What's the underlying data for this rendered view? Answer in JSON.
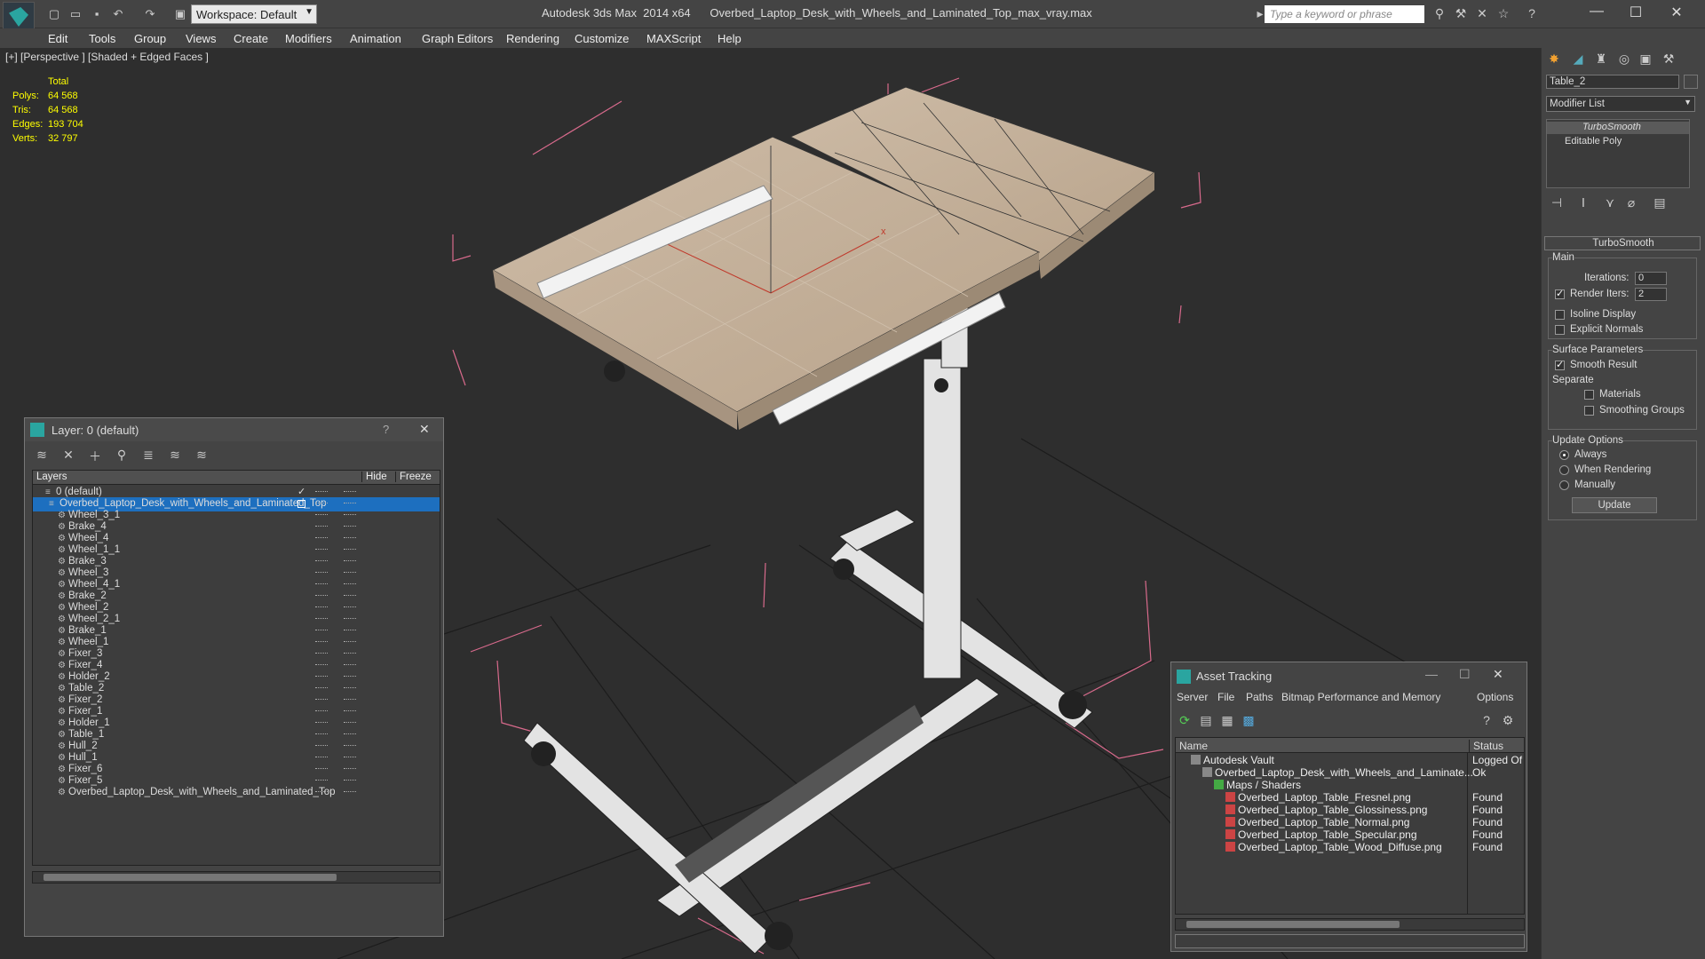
{
  "app": {
    "title": "Autodesk 3ds Max  2014 x64      Overbed_Laptop_Desk_with_Wheels_and_Laminated_Top_max_vray.max",
    "workspace": "Workspace: Default",
    "search_placeholder": "Type a keyword or phrase"
  },
  "menu": [
    "Edit",
    "Tools",
    "Group",
    "Views",
    "Create",
    "Modifiers",
    "Animation",
    "Graph Editors",
    "Rendering",
    "Customize",
    "MAXScript",
    "Help"
  ],
  "viewport": {
    "label": "[+] [Perspective ] [Shaded + Edged Faces ]",
    "stats": {
      "header": "Total",
      "rows": [
        {
          "label": "Polys:",
          "value": "64 568"
        },
        {
          "label": "Tris:",
          "value": "64 568"
        },
        {
          "label": "Edges:",
          "value": "193 704"
        },
        {
          "label": "Verts:",
          "value": "32 797"
        }
      ]
    }
  },
  "command_panel": {
    "object_name": "Table_2",
    "modifier_list": "Modifier List",
    "stack": [
      "TurboSmooth",
      "Editable Poly"
    ],
    "rollout_title": "TurboSmooth",
    "main_label": "Main",
    "iterations_label": "Iterations:",
    "iterations_value": "0",
    "render_iters_label": "Render Iters:",
    "render_iters_value": "2",
    "isoline": "Isoline Display",
    "explicit_normals": "Explicit Normals",
    "surface_params": "Surface Parameters",
    "smooth_result": "Smooth Result",
    "separate": "Separate",
    "materials": "Materials",
    "smoothing_groups": "Smoothing Groups",
    "update_options": "Update Options",
    "always": "Always",
    "when_rendering": "When Rendering",
    "manually": "Manually",
    "update_button": "Update"
  },
  "layer_window": {
    "title": "Layer: 0 (default)",
    "help": "?",
    "columns": [
      "Layers",
      "Hide",
      "Freeze"
    ],
    "default_layer": "0 (default)",
    "selected_layer": "Overbed_Laptop_Desk_with_Wheels_and_Laminated_Top",
    "objects": [
      "Wheel_3_1",
      "Brake_4",
      "Wheel_4",
      "Wheel_1_1",
      "Brake_3",
      "Wheel_3",
      "Wheel_4_1",
      "Brake_2",
      "Wheel_2",
      "Wheel_2_1",
      "Brake_1",
      "Wheel_1",
      "Fixer_3",
      "Fixer_4",
      "Holder_2",
      "Table_2",
      "Fixer_2",
      "Fixer_1",
      "Holder_1",
      "Table_1",
      "Hull_2",
      "Hull_1",
      "Fixer_6",
      "Fixer_5",
      "Overbed_Laptop_Desk_with_Wheels_and_Laminated_Top"
    ]
  },
  "asset_window": {
    "title": "Asset Tracking",
    "menus": [
      "Server",
      "File",
      "Paths",
      "Bitmap Performance and Memory",
      "Options"
    ],
    "columns": [
      "Name",
      "Status"
    ],
    "rows": [
      {
        "name": "Autodesk Vault",
        "status": "Logged Of",
        "indent": 1
      },
      {
        "name": "Overbed_Laptop_Desk_with_Wheels_and_Laminate...",
        "status": "Ok",
        "indent": 2
      },
      {
        "name": "Maps / Shaders",
        "status": "",
        "indent": 3
      },
      {
        "name": "Overbed_Laptop_Table_Fresnel.png",
        "status": "Found",
        "indent": 4
      },
      {
        "name": "Overbed_Laptop_Table_Glossiness.png",
        "status": "Found",
        "indent": 4
      },
      {
        "name": "Overbed_Laptop_Table_Normal.png",
        "status": "Found",
        "indent": 4
      },
      {
        "name": "Overbed_Laptop_Table_Specular.png",
        "status": "Found",
        "indent": 4
      },
      {
        "name": "Overbed_Laptop_Table_Wood_Diffuse.png",
        "status": "Found",
        "indent": 4
      }
    ]
  }
}
